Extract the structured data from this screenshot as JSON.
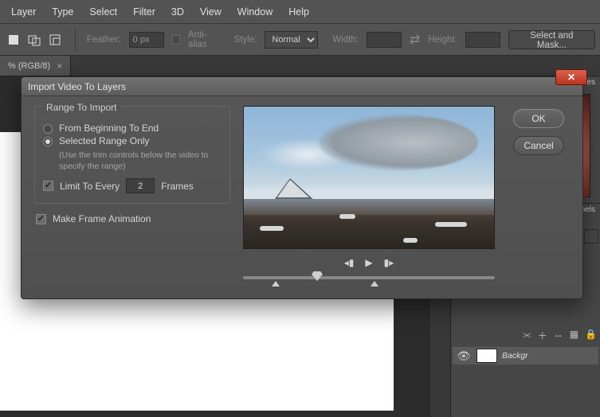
{
  "menu": {
    "items": [
      "Layer",
      "Type",
      "Select",
      "Filter",
      "3D",
      "View",
      "Window",
      "Help"
    ]
  },
  "options": {
    "feather_label": "Feather:",
    "feather_value": "0 px",
    "anti_alias": "Anti-alias",
    "style_label": "Style:",
    "style_value": "Normal",
    "width_label": "Width:",
    "height_label": "Height:",
    "mask_btn": "Select and Mask..."
  },
  "doc": {
    "tab_label": "% (RGB/8)",
    "close": "×"
  },
  "right": {
    "swatches_hint": "atches",
    "channels_hint": "annels",
    "bg_layer": "Backgr"
  },
  "dialog": {
    "title": "Import Video To Layers",
    "legend": "Range To Import",
    "opt_full": "From Beginning To End",
    "opt_range": "Selected Range Only",
    "hint": "(Use the trim controls below the video to specify the range)",
    "limit_label": "Limit To Every",
    "limit_value": "2",
    "frames": "Frames",
    "make_anim": "Make Frame Animation",
    "ok": "OK",
    "cancel": "Cancel"
  }
}
